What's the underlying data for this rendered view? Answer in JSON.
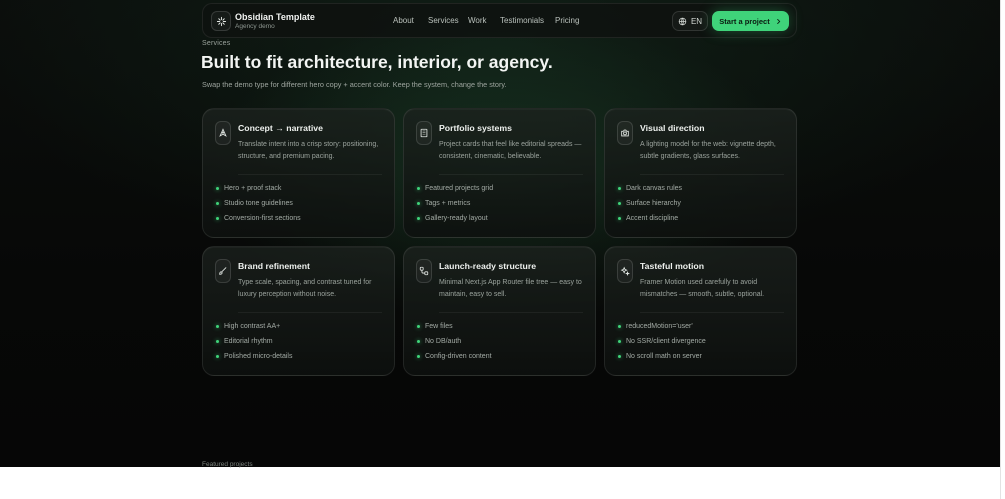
{
  "header": {
    "brand_title": "Obsidian Template",
    "brand_subtitle": "Agency demo",
    "brand_icon": "sparkle-icon",
    "nav": [
      "About",
      "Services",
      "Work",
      "Testimonials",
      "Pricing"
    ],
    "language_label": "EN",
    "language_icon": "globe-icon",
    "cta_label": "Start a project",
    "cta_icon": "chevron-right-icon"
  },
  "section": {
    "eyebrow": "Services",
    "headline": "Built to fit architecture, interior, or agency.",
    "subline": "Swap the demo type for different hero copy + accent color. Keep the system, change the story."
  },
  "cards": [
    {
      "icon": "pen-tool-icon",
      "title": "Concept → narrative",
      "description": "Translate intent into a crisp story: positioning, structure, and premium pacing.",
      "bullets": [
        "Hero + proof stack",
        "Studio tone guidelines",
        "Conversion-first sections"
      ]
    },
    {
      "icon": "building-icon",
      "title": "Portfolio systems",
      "description": "Project cards that feel like editorial spreads — consistent, cinematic, believable.",
      "bullets": [
        "Featured projects grid",
        "Tags + metrics",
        "Gallery-ready layout"
      ]
    },
    {
      "icon": "camera-icon",
      "title": "Visual direction",
      "description": "A lighting model for the web: vignette depth, subtle gradients, glass surfaces.",
      "bullets": [
        "Dark canvas rules",
        "Surface hierarchy",
        "Accent discipline"
      ]
    },
    {
      "icon": "brush-icon",
      "title": "Brand refinement",
      "description": "Type scale, spacing, and contrast tuned for luxury perception without noise.",
      "bullets": [
        "High contrast AA+",
        "Editorial rhythm",
        "Polished micro-details"
      ]
    },
    {
      "icon": "workflow-icon",
      "title": "Launch-ready structure",
      "description": "Minimal Next.js App Router file tree — easy to maintain, easy to sell.",
      "bullets": [
        "Few files",
        "No DB/auth",
        "Config-driven content"
      ]
    },
    {
      "icon": "sparkles-icon",
      "title": "Tasteful motion",
      "description": "Framer Motion used carefully to avoid mismatches — smooth, subtle, optional.",
      "bullets": [
        "reducedMotion='user'",
        "No SSR/client divergence",
        "No scroll math on server"
      ]
    }
  ],
  "next_section_eyebrow": "Featured projects",
  "colors": {
    "accent": "#3fd37a",
    "background": "#080a09",
    "card": "#161b18",
    "text": "#eef1ee",
    "muted": "#9ba39d"
  }
}
